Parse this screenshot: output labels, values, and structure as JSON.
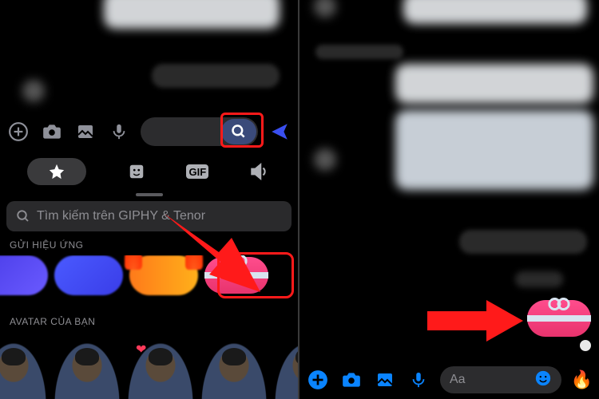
{
  "left": {
    "giphy_placeholder": "Tìm kiếm trên GIPHY & Tenor",
    "section_effects": "GỬI HIỆU ỨNG",
    "section_avatars": "AVATAR CỦA BẠN",
    "tabs": {
      "gif": "GIF"
    }
  },
  "right": {
    "input_placeholder": "Aa"
  },
  "colors": {
    "accent_blue": "#0a84ff",
    "send_blue": "#3a4ff0",
    "highlight_red": "#ff1a1a",
    "gift_pink": "#ff4d8d"
  }
}
